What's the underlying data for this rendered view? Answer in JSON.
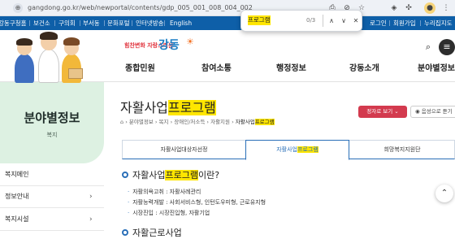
{
  "browser": {
    "url": "gangdong.go.kr/web/newportal/contents/gdp_005_001_008_004_002",
    "icons": [
      "lock-icon",
      "install-icon",
      "eye-off-icon",
      "star-icon",
      "shield-icon",
      "extensions-icon",
      "profile-icon"
    ]
  },
  "find_bar": {
    "query": "프로그램",
    "count": "0/3"
  },
  "gnb": {
    "items": [
      "강동구청홈",
      "보건소",
      "구의회",
      "부서동",
      "문화포털",
      "인터넷방송",
      "English"
    ],
    "right_items": [
      "로그인",
      "회원가입",
      "누리집지도"
    ]
  },
  "logo": {
    "slogan": "힘찬변화 자랑스러운",
    "name": "강동"
  },
  "main_nav": [
    "종합민원",
    "참여소통",
    "행정정보",
    "강동소개",
    "분야별정보"
  ],
  "sidebar": {
    "title": "분야별정보",
    "subtitle": "복지",
    "items": [
      {
        "label": "복지메인"
      },
      {
        "label": "정보안내"
      },
      {
        "label": "복지시설"
      }
    ]
  },
  "page": {
    "title_prefix": "자활사업",
    "title_highlight": "프로그램",
    "breadcrumb": [
      "분야별정보",
      "복지",
      "장애인/저소득",
      "자활지원"
    ],
    "breadcrumb_current_prefix": "자활사업",
    "breadcrumb_current_highlight": "프로그램",
    "share_label": "정자로 보기",
    "read_label": "음성으로 듣기"
  },
  "tabs": [
    {
      "label": "자활사업대상자선정",
      "active": false
    },
    {
      "label_prefix": "자활사업",
      "label_highlight": "프로그램",
      "active": true
    },
    {
      "label": "희망복지지원단",
      "active": false
    }
  ],
  "section": {
    "heading_prefix": "자활사업",
    "heading_highlight": "프로그램",
    "heading_suffix": "이란?",
    "bullets": [
      "자활의욕고취 : 자활사례관리",
      "자활능력개발 : 사회서비스형, 인턴도우미형, 근로유지형",
      "시장진입 : 시장진입형, 자활기업"
    ],
    "next_heading": "자활근로사업"
  },
  "colors": {
    "gnb_bg": "#0e5fa8",
    "highlight": "#ffe600",
    "share_btn": "#d33a4e",
    "accent": "#2a6fb8",
    "sidebar_bg": "#ddf1e2"
  }
}
